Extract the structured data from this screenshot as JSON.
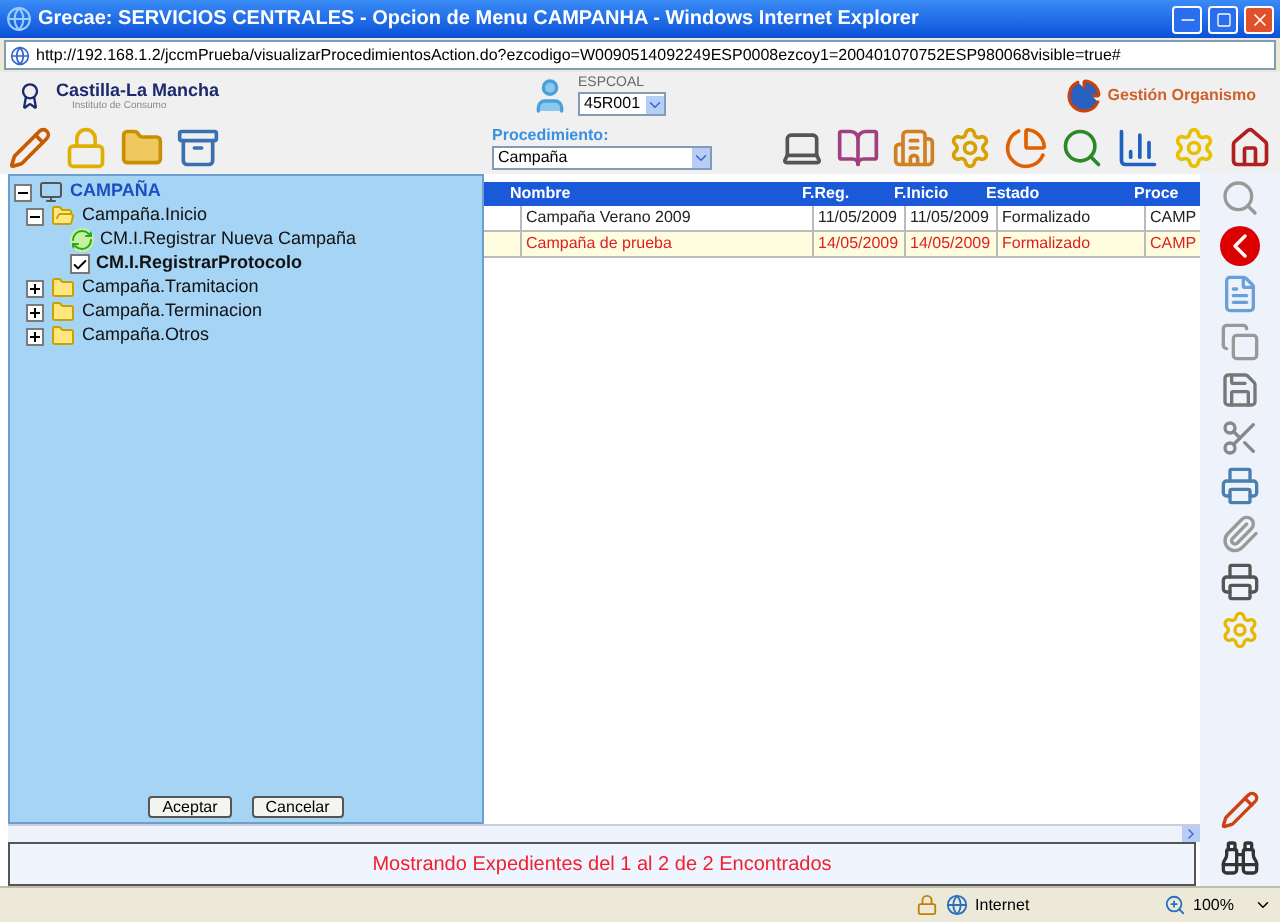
{
  "window": {
    "title": "Grecae: SERVICIOS CENTRALES - Opcion de Menu CAMPANHA - Windows Internet Explorer"
  },
  "address": "http://192.168.1.2/jccmPrueba/visualizarProcedimientosAction.do?ezcodigo=W0090514092249ESP0008ezcoy1=200401070752ESP980068visible=true#",
  "header": {
    "brand": "Castilla-La Mancha",
    "subtitle": "Instituto de Consumo",
    "user": "ESPCOAL",
    "user_select": "45R001",
    "organismo": "Gestión Organismo"
  },
  "procedimiento": {
    "label": "Procedimiento:",
    "value": "Campaña"
  },
  "tree": {
    "label": "CAMPAÑA",
    "expanded": true,
    "children": [
      {
        "label": "Campaña.Inicio",
        "kind": "folder",
        "expanded": true,
        "children": [
          {
            "label": "CM.I.Registrar Nueva Campaña",
            "kind": "action",
            "selected": false
          },
          {
            "label": "CM.I.RegistrarProtocolo",
            "kind": "check",
            "checked": true,
            "selected": true
          }
        ]
      },
      {
        "label": "Campaña.Tramitacion",
        "kind": "folder",
        "expanded": false
      },
      {
        "label": "Campaña.Terminacion",
        "kind": "folder",
        "expanded": false
      },
      {
        "label": "Campaña.Otros",
        "kind": "folder",
        "expanded": false
      }
    ]
  },
  "dialog_buttons": [
    "Aceptar",
    "Cancelar"
  ],
  "table": {
    "columns": [
      "Nombre",
      "F.Reg.",
      "F.Inicio",
      "Estado",
      "Proce"
    ],
    "rows": [
      {
        "cells": [
          "Campaña Verano 2009",
          "11/05/2009",
          "11/05/2009",
          "Formalizado",
          "CAMP"
        ],
        "selected": false
      },
      {
        "cells": [
          "Campaña de prueba",
          "14/05/2009",
          "14/05/2009",
          "Formalizado",
          "CAMP"
        ],
        "selected": true
      }
    ]
  },
  "message": "Mostrando Expedientes del 1 al 2 de 2 Encontrados",
  "status_bar": {
    "zone": "Internet",
    "zoom": "100%"
  }
}
